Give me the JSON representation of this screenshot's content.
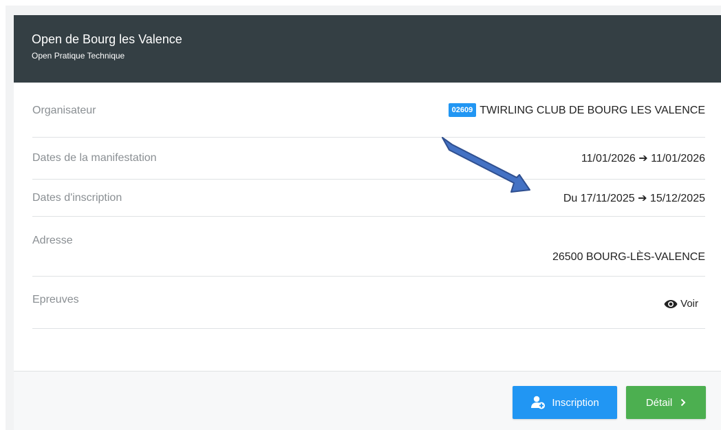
{
  "event": {
    "title": "Open de Bourg les Valence",
    "subtitle": "Open Pratique Technique"
  },
  "details": {
    "organisateur": {
      "label": "Organisateur",
      "badge": "02609",
      "value": "TWIRLING CLUB DE BOURG LES VALENCE"
    },
    "dates_manifestation": {
      "label": "Dates de la manifestation",
      "value": "11/01/2026 ➔ 11/01/2026"
    },
    "dates_inscription": {
      "label": "Dates d'inscription",
      "value": "Du 17/11/2025 ➔ 15/12/2025"
    },
    "adresse": {
      "label": "Adresse",
      "value": "26500 BOURG-LÈS-VALENCE"
    },
    "epreuves": {
      "label": "Epreuves",
      "link": "Voir",
      "icon": "eye-icon"
    }
  },
  "footer": {
    "inscription_label": "Inscription",
    "inscription_icon": "add-user-icon",
    "detail_label": "Détail",
    "detail_icon": "chevron-right-icon"
  },
  "colors": {
    "header_bg": "#343f44",
    "badge": "#2196f3",
    "inscription_btn": "#2196f3",
    "detail_btn": "#4caf50",
    "annotation_arrow": "#4472c4"
  }
}
